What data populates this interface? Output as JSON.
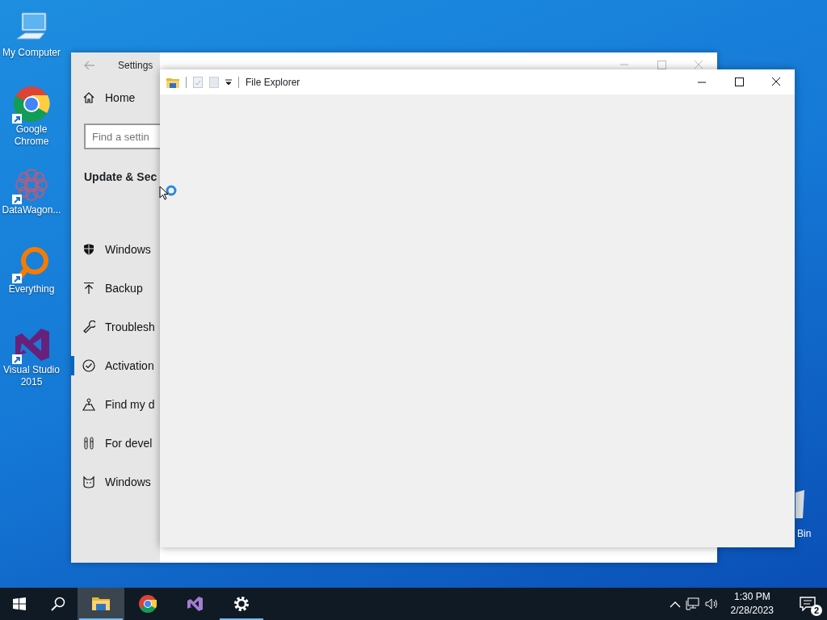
{
  "desktop_icons": [
    {
      "kind": "computer",
      "label": "My Computer",
      "shortcut": false
    },
    {
      "kind": "chrome",
      "label": "Google Chrome",
      "shortcut": true
    },
    {
      "kind": "datawagon",
      "label": "DataWagon...",
      "shortcut": true
    },
    {
      "kind": "everything",
      "label": "Everything",
      "shortcut": true
    },
    {
      "kind": "vs",
      "label": "Visual Studio 2015",
      "shortcut": true
    }
  ],
  "recycle_bin": {
    "label": "Bin"
  },
  "settings": {
    "title": "Settings",
    "home": "Home",
    "search": {
      "placeholder": "Find a settin"
    },
    "section": "Update & Sec",
    "items": [
      {
        "kind": "shield",
        "label": "Windows",
        "selected": false
      },
      {
        "kind": "backup",
        "label": "Backup",
        "selected": false
      },
      {
        "kind": "wrench",
        "label": "Troublesh",
        "selected": false
      },
      {
        "kind": "check",
        "label": "Activation",
        "selected": true
      },
      {
        "kind": "find",
        "label": "Find my d",
        "selected": false
      },
      {
        "kind": "dev",
        "label": "For devel",
        "selected": false
      },
      {
        "kind": "insider",
        "label": "Windows",
        "selected": false
      }
    ]
  },
  "explorer": {
    "title": "File Explorer"
  },
  "taskbar": {
    "apps": [
      {
        "kind": "explorer",
        "selected": true,
        "running": true
      },
      {
        "kind": "chrome",
        "selected": false,
        "running": false
      },
      {
        "kind": "vs",
        "selected": false,
        "running": false
      },
      {
        "kind": "settings",
        "selected": false,
        "running": true
      }
    ],
    "time": "1:30 PM",
    "date": "2/28/2023",
    "notifications": "2"
  }
}
